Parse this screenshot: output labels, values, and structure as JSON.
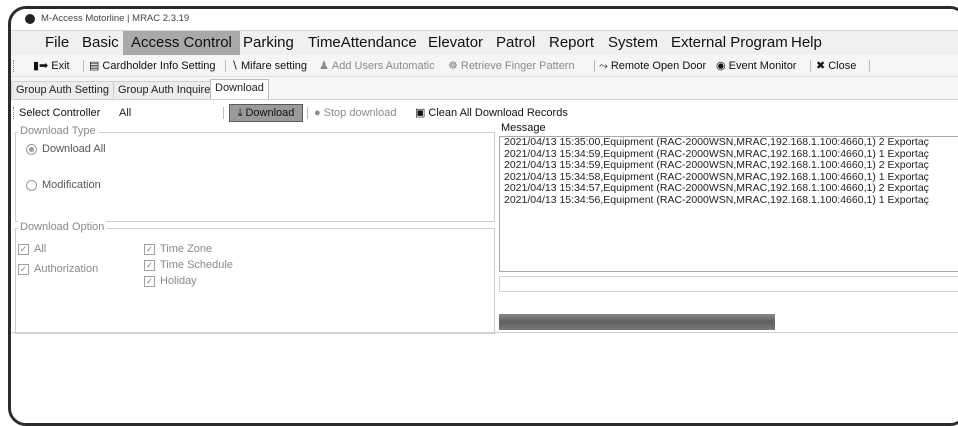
{
  "window": {
    "title": "M-Access Motorline | MRAC  2.3.19"
  },
  "menu": [
    "File",
    "Basic",
    "Access Control",
    "Parking",
    "TimeAttendance",
    "Elevator",
    "Patrol",
    "Report",
    "System",
    "External Program",
    "Help"
  ],
  "toolbar": {
    "exit": "Exit",
    "cardholder": "Cardholder Info Setting",
    "mifare": "Mifare setting",
    "add_users": "Add Users Automatic",
    "retrieve_finger": "Retrieve Finger Pattern",
    "remote_open": "Remote Open Door",
    "event_monitor": "Event Monitor",
    "close": "Close"
  },
  "tabs": [
    "Group Auth Setting",
    "Group Auth Inquire",
    "Download"
  ],
  "download_bar": {
    "select_controller_label": "Select Controller",
    "select_controller_value": "All",
    "download": "Download",
    "stop_download": "Stop download",
    "clean_records": "Clean All Download Records"
  },
  "download_type": {
    "title": "Download Type",
    "download_all": "Download All",
    "modification": "Modification"
  },
  "download_option": {
    "title": "Download Option",
    "all": "All",
    "authorization": "Authorization",
    "time_zone": "Time Zone",
    "time_schedule": "Time Schedule",
    "holiday": "Holiday"
  },
  "message": {
    "label": "Message",
    "lines": [
      "2021/04/13 15:35:00,Equipment (RAC-2000WSN,MRAC,192.168.1.100:4660,1)  2 Exportaç",
      "2021/04/13 15:34:59,Equipment (RAC-2000WSN,MRAC,192.168.1.100:4660,1)  1 Exportaç",
      "2021/04/13 15:34:59,Equipment (RAC-2000WSN,MRAC,192.168.1.100:4660,1)  2 Exportaç",
      "2021/04/13 15:34:58,Equipment (RAC-2000WSN,MRAC,192.168.1.100:4660,1)  1 Exportaç",
      "2021/04/13 15:34:57,Equipment (RAC-2000WSN,MRAC,192.168.1.100:4660,1)  2 Exportaç",
      "2021/04/13 15:34:56,Equipment (RAC-2000WSN,MRAC,192.168.1.100:4660,1)  1 Exportaç"
    ]
  },
  "icons": {
    "exit": "exit-icon",
    "cardholder": "id-card-icon",
    "mifare": "wand-icon",
    "add_users": "users-icon",
    "retrieve_finger": "fingerprint-icon",
    "remote_open": "door-icon",
    "event_monitor": "eye-icon",
    "close": "close-icon",
    "download": "download-icon",
    "stop": "stop-icon",
    "clean": "trash-icon"
  },
  "colors": {
    "active_menu_bg": "#a9a9a9",
    "download_button_bg": "#9a9a9a",
    "frame": "#2c2c2c"
  }
}
